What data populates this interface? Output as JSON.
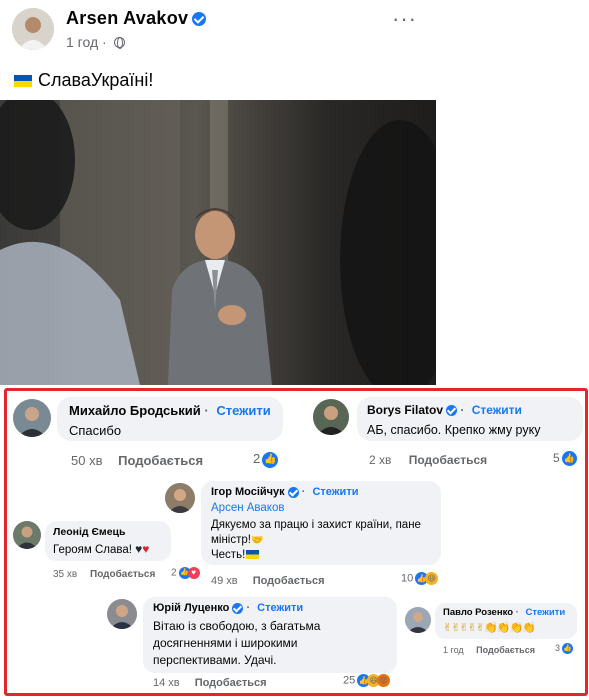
{
  "post": {
    "author": "Arsen  Avakov",
    "time": "1 год",
    "separator": "·",
    "more": "···",
    "text": "СлаваУкраїні!"
  },
  "comments": [
    {
      "name": "Михайло Бродський",
      "follow": "Стежити",
      "text": "Спасибо",
      "time": "50 хв",
      "like": "Подобається",
      "reactions": "2"
    },
    {
      "name": "Borys Filatov",
      "follow": "Стежити",
      "text": "АБ, спасибо. Крепко жму руку",
      "time": "2 хв",
      "like": "Подобається",
      "reactions": "5"
    },
    {
      "name": "Ігор Мосійчук",
      "follow": "Стежити",
      "tag": "Арсен Аваков",
      "text": "Дякуємо за працю і захист країни, пане міністр!",
      "text2": "Честь!",
      "time": "49 хв",
      "like": "Подобається",
      "reactions": "10"
    },
    {
      "name": "Леонід Ємець",
      "text": "Героям Слава!",
      "time": "35 хв",
      "like": "Подобається",
      "reactions": "2"
    },
    {
      "name": "Юрій Луценко",
      "follow": "Стежити",
      "text": "Вітаю із свободою, з багатьма досягненнями і широкими перспективами. Удачі.",
      "time": "14 хв",
      "like": "Подобається",
      "reactions": "25"
    },
    {
      "name": "Павло Розенко",
      "follow": "Стежити",
      "text": "✌✌✌✌✌👏👏👏👏",
      "time": "1 год",
      "like": "Подобається",
      "reactions": "3"
    }
  ],
  "colors": {
    "accent": "#1877f2",
    "highlight_border": "#e2262d",
    "bubble": "#f0f2f5"
  }
}
